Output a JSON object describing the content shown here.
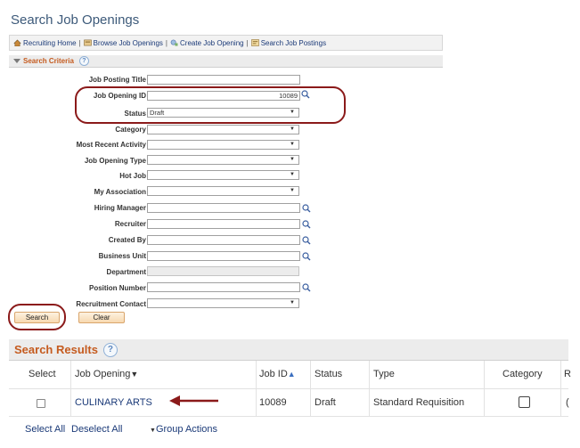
{
  "page": {
    "title": "Search Job Openings"
  },
  "nav": {
    "links": [
      {
        "label": "Recruiting Home",
        "icon": "home-icon"
      },
      {
        "label": "Browse Job Openings",
        "icon": "browse-icon"
      },
      {
        "label": "Create Job Opening",
        "icon": "create-icon"
      },
      {
        "label": "Search Job Postings",
        "icon": "postings-icon"
      }
    ],
    "separator": "|"
  },
  "criteria": {
    "title": "Search Criteria",
    "help": "?",
    "fields": {
      "job_posting_title": {
        "label": "Job Posting Title",
        "value": ""
      },
      "job_opening_id": {
        "label": "Job Opening ID",
        "value": "10089"
      },
      "status": {
        "label": "Status",
        "value": "Draft"
      },
      "category": {
        "label": "Category",
        "value": ""
      },
      "most_recent_activity": {
        "label": "Most Recent Activity",
        "value": ""
      },
      "job_opening_type": {
        "label": "Job Opening Type",
        "value": ""
      },
      "hot_job": {
        "label": "Hot Job",
        "value": ""
      },
      "my_association": {
        "label": "My Association",
        "value": ""
      },
      "hiring_manager": {
        "label": "Hiring Manager",
        "value": ""
      },
      "recruiter": {
        "label": "Recruiter",
        "value": ""
      },
      "created_by": {
        "label": "Created By",
        "value": ""
      },
      "business_unit": {
        "label": "Business Unit",
        "value": ""
      },
      "department": {
        "label": "Department",
        "value": ""
      },
      "position_number": {
        "label": "Position Number",
        "value": ""
      },
      "recruitment_contact": {
        "label": "Recruitment Contact",
        "value": ""
      }
    },
    "search_label": "Search",
    "clear_label": "Clear"
  },
  "results": {
    "title": "Search Results",
    "help": "?",
    "columns": {
      "select": "Select",
      "job_opening": "Job Opening",
      "job_id": "Job ID",
      "status": "Status",
      "type": "Type",
      "category": "Category",
      "overflow": "R"
    },
    "sort_down": "▼",
    "sort_up": "▲",
    "rows": [
      {
        "job_opening": "CULINARY ARTS",
        "job_id": "10089",
        "status": "Draft",
        "type": "Standard Requisition",
        "overflow": "("
      }
    ],
    "footer": {
      "select_all": "Select All",
      "deselect_all": "Deselect All",
      "group_actions": "Group Actions"
    }
  },
  "annotation_color": "#8b1a1a"
}
